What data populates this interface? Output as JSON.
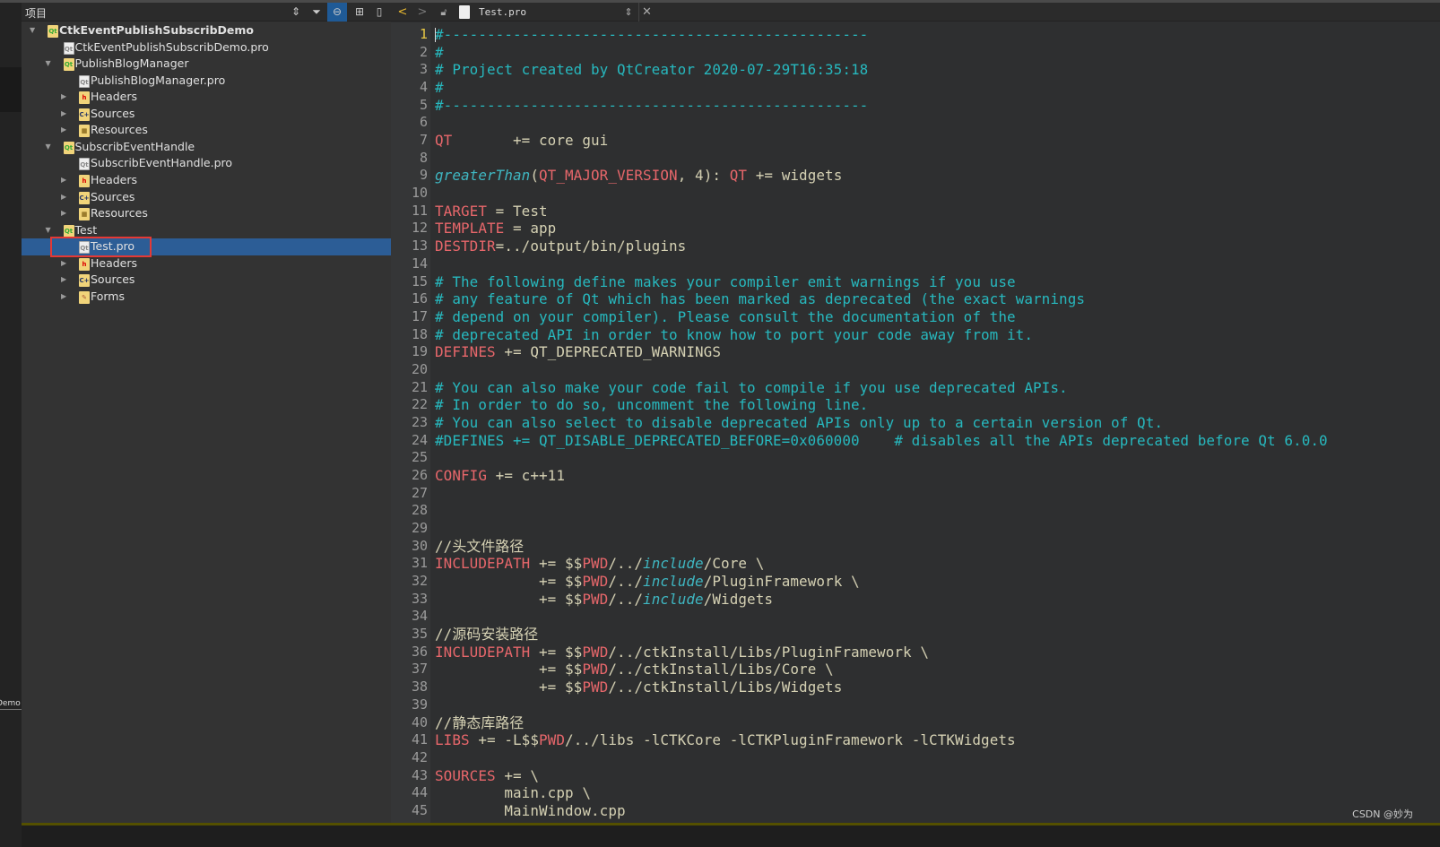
{
  "colors": {
    "selection": "#2c5d96",
    "comment": "#27b9bf",
    "keyword": "#e8676b",
    "text": "#d6d2b4",
    "highlight_box": "#e53935"
  },
  "left_strip": {
    "fragment": "Demo"
  },
  "panel": {
    "title": "项目"
  },
  "tree": [
    {
      "label": "CtkEventPublishSubscribDemo",
      "level": 0,
      "icon": "qt-project-folder",
      "expanded": true,
      "bold": true
    },
    {
      "label": "CtkEventPublishSubscribDemo.pro",
      "level": 1,
      "icon": "pro-file"
    },
    {
      "label": "PublishBlogManager",
      "level": 1,
      "icon": "qt-project-folder",
      "expanded": true
    },
    {
      "label": "PublishBlogManager.pro",
      "level": 2,
      "icon": "pro-file"
    },
    {
      "label": "Headers",
      "level": 2,
      "icon": "headers-folder",
      "expanded": false
    },
    {
      "label": "Sources",
      "level": 2,
      "icon": "sources-folder",
      "expanded": false
    },
    {
      "label": "Resources",
      "level": 2,
      "icon": "resources-folder",
      "expanded": false
    },
    {
      "label": "SubscribEventHandle",
      "level": 1,
      "icon": "qt-project-folder",
      "expanded": true
    },
    {
      "label": "SubscribEventHandle.pro",
      "level": 2,
      "icon": "pro-file"
    },
    {
      "label": "Headers",
      "level": 2,
      "icon": "headers-folder",
      "expanded": false
    },
    {
      "label": "Sources",
      "level": 2,
      "icon": "sources-folder",
      "expanded": false
    },
    {
      "label": "Resources",
      "level": 2,
      "icon": "resources-folder",
      "expanded": false
    },
    {
      "label": "Test",
      "level": 1,
      "icon": "qt-project-folder",
      "expanded": true
    },
    {
      "label": "Test.pro",
      "level": 2,
      "icon": "pro-file",
      "selected": true
    },
    {
      "label": "Headers",
      "level": 2,
      "icon": "headers-folder",
      "expanded": false
    },
    {
      "label": "Sources",
      "level": 2,
      "icon": "sources-folder",
      "expanded": false
    },
    {
      "label": "Forms",
      "level": 2,
      "icon": "forms-folder",
      "expanded": false
    }
  ],
  "editor": {
    "file_name": "Test.pro",
    "current_line": 1,
    "lines": [
      [
        [
          "c",
          "#-------------------------------------------------"
        ]
      ],
      [
        [
          "c",
          "#"
        ]
      ],
      [
        [
          "c",
          "# Project created by QtCreator 2020-07-29T16:35:18"
        ]
      ],
      [
        [
          "c",
          "#"
        ]
      ],
      [
        [
          "c",
          "#-------------------------------------------------"
        ]
      ],
      [],
      [
        [
          "k",
          "QT"
        ],
        [
          "t",
          "       += core gui"
        ]
      ],
      [],
      [
        [
          "f",
          "greaterThan"
        ],
        [
          "t",
          "("
        ],
        [
          "k",
          "QT_MAJOR_VERSION"
        ],
        [
          "t",
          ", 4): "
        ],
        [
          "k",
          "QT"
        ],
        [
          "t",
          " += widgets"
        ]
      ],
      [],
      [
        [
          "k",
          "TARGET"
        ],
        [
          "t",
          " = Test"
        ]
      ],
      [
        [
          "k",
          "TEMPLATE"
        ],
        [
          "t",
          " = app"
        ]
      ],
      [
        [
          "k",
          "DESTDIR"
        ],
        [
          "t",
          "=../output/bin/plugins"
        ]
      ],
      [],
      [
        [
          "c",
          "# The following define makes your compiler emit warnings if you use"
        ]
      ],
      [
        [
          "c",
          "# any feature of Qt which has been marked as deprecated (the exact warnings"
        ]
      ],
      [
        [
          "c",
          "# depend on your compiler). Please consult the documentation of the"
        ]
      ],
      [
        [
          "c",
          "# deprecated API in order to know how to port your code away from it."
        ]
      ],
      [
        [
          "k",
          "DEFINES"
        ],
        [
          "t",
          " += QT_DEPRECATED_WARNINGS"
        ]
      ],
      [],
      [
        [
          "c",
          "# You can also make your code fail to compile if you use deprecated APIs."
        ]
      ],
      [
        [
          "c",
          "# In order to do so, uncomment the following line."
        ]
      ],
      [
        [
          "c",
          "# You can also select to disable deprecated APIs only up to a certain version of Qt."
        ]
      ],
      [
        [
          "c",
          "#DEFINES += QT_DISABLE_DEPRECATED_BEFORE=0x060000    # disables all the APIs deprecated before Qt 6.0.0"
        ]
      ],
      [],
      [
        [
          "k",
          "CONFIG"
        ],
        [
          "t",
          " += c++11"
        ]
      ],
      [],
      [],
      [],
      [
        [
          "t",
          "//头文件路径"
        ]
      ],
      [
        [
          "k",
          "INCLUDEPATH"
        ],
        [
          "t",
          " += $$"
        ],
        [
          "k",
          "PWD"
        ],
        [
          "t",
          "/../"
        ],
        [
          "f",
          "include"
        ],
        [
          "t",
          "/Core \\"
        ]
      ],
      [
        [
          "t",
          "            += $$"
        ],
        [
          "k",
          "PWD"
        ],
        [
          "t",
          "/../"
        ],
        [
          "f",
          "include"
        ],
        [
          "t",
          "/PluginFramework \\"
        ]
      ],
      [
        [
          "t",
          "            += $$"
        ],
        [
          "k",
          "PWD"
        ],
        [
          "t",
          "/../"
        ],
        [
          "f",
          "include"
        ],
        [
          "t",
          "/Widgets"
        ]
      ],
      [],
      [
        [
          "t",
          "//源码安装路径"
        ]
      ],
      [
        [
          "k",
          "INCLUDEPATH"
        ],
        [
          "t",
          " += $$"
        ],
        [
          "k",
          "PWD"
        ],
        [
          "t",
          "/../ctkInstall/Libs/PluginFramework \\"
        ]
      ],
      [
        [
          "t",
          "            += $$"
        ],
        [
          "k",
          "PWD"
        ],
        [
          "t",
          "/../ctkInstall/Libs/Core \\"
        ]
      ],
      [
        [
          "t",
          "            += $$"
        ],
        [
          "k",
          "PWD"
        ],
        [
          "t",
          "/../ctkInstall/Libs/Widgets"
        ]
      ],
      [],
      [
        [
          "t",
          "//静态库路径"
        ]
      ],
      [
        [
          "k",
          "LIBS"
        ],
        [
          "t",
          " += -L$$"
        ],
        [
          "k",
          "PWD"
        ],
        [
          "t",
          "/../libs -lCTKCore -lCTKPluginFramework -lCTKWidgets"
        ]
      ],
      [],
      [
        [
          "k",
          "SOURCES"
        ],
        [
          "t",
          " += \\"
        ]
      ],
      [
        [
          "t",
          "        main.cpp \\"
        ]
      ],
      [
        [
          "t",
          "        MainWindow.cpp"
        ]
      ]
    ]
  },
  "watermark": "CSDN @妙为"
}
